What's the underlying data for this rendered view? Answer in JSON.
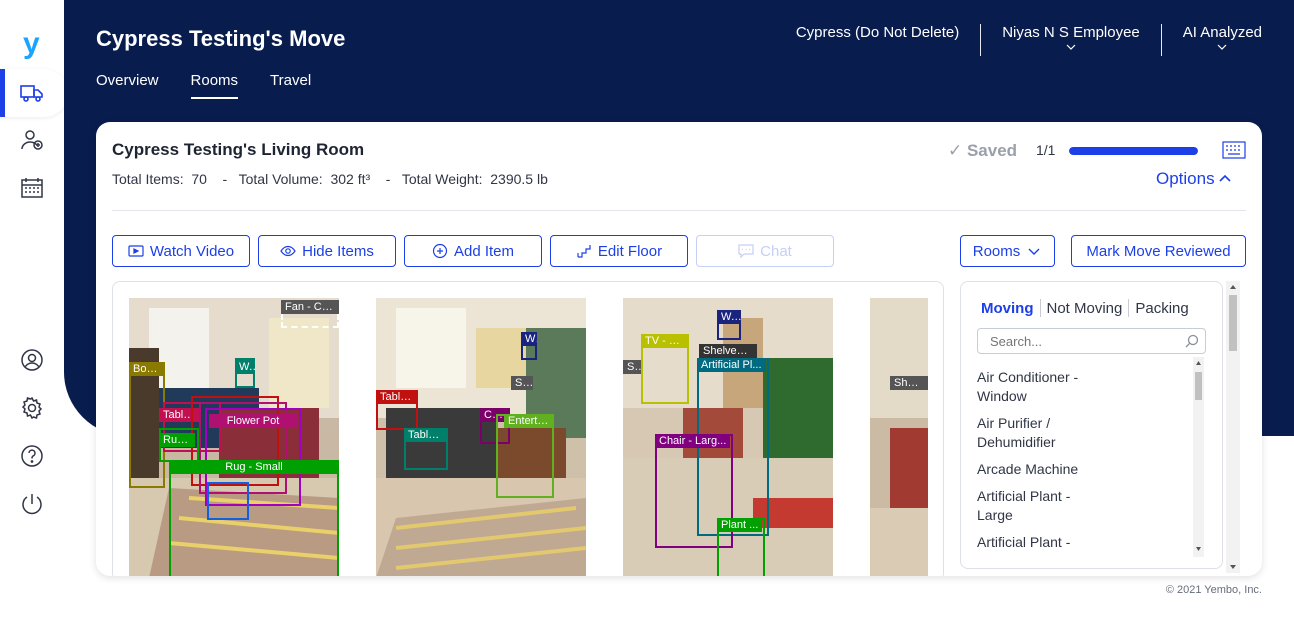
{
  "colors": {
    "accent": "#1d3fe8",
    "header_bg": "#091c4e"
  },
  "logo": "y",
  "sidebar": {
    "items": [
      {
        "name": "truck-icon",
        "active": true
      },
      {
        "name": "add-user-icon"
      },
      {
        "name": "calendar-icon"
      },
      {
        "name": "profile-icon"
      },
      {
        "name": "gear-icon"
      },
      {
        "name": "help-icon"
      },
      {
        "name": "power-icon"
      }
    ]
  },
  "header": {
    "title": "Cypress Testing's Move",
    "tabs": [
      {
        "label": "Overview",
        "active": false
      },
      {
        "label": "Rooms",
        "active": true
      },
      {
        "label": "Travel",
        "active": false
      }
    ],
    "right": {
      "company": "Cypress (Do Not Delete)",
      "user": "Niyas N S Employee",
      "status": "AI Analyzed"
    }
  },
  "room": {
    "title": "Cypress Testing's Living Room",
    "stats": {
      "items_label": "Total Items:",
      "items_value": "70",
      "volume_label": "Total Volume:",
      "volume_value": "302 ft³",
      "weight_label": "Total Weight:",
      "weight_value": "2390.5 lb",
      "sep": "-"
    },
    "saved": "✓ Saved",
    "count": "1/1",
    "progress": 1.0,
    "options": "Options"
  },
  "toolbar": {
    "watch_video": "Watch Video",
    "hide_items": "Hide Items",
    "add_item": "Add Item",
    "edit_floor": "Edit Floor",
    "chat": "Chat",
    "rooms": "Rooms",
    "mark_reviewed": "Mark Move Reviewed"
  },
  "photos": [
    {
      "labels": [
        "Fan - Ce...",
        "Boo...",
        "W...",
        "Table...",
        "Flower Pot",
        "Rug...",
        "Rug - Small"
      ]
    },
    {
      "labels": [
        "W",
        "S...",
        "Table...",
        "Table ...",
        "Ch...",
        "Entertai..."
      ]
    },
    {
      "labels": [
        "W...",
        "TV - Fl...",
        "Shelves ...",
        "S...",
        "Artificial Pl...",
        "Chair - Larg...",
        "Plant ..."
      ]
    },
    {
      "labels": [
        "Shelve"
      ]
    }
  ],
  "item_panel": {
    "tabs": [
      {
        "label": "Moving",
        "active": true
      },
      {
        "label": "Not Moving",
        "active": false
      },
      {
        "label": "Packing",
        "active": false
      }
    ],
    "search_placeholder": "Search...",
    "items": [
      "Air Conditioner - Window",
      "Air Purifier / Dehumidifier",
      "Arcade Machine",
      "Artificial Plant - Large",
      "Artificial Plant -"
    ]
  },
  "footer": "© 2021 Yembo, Inc."
}
